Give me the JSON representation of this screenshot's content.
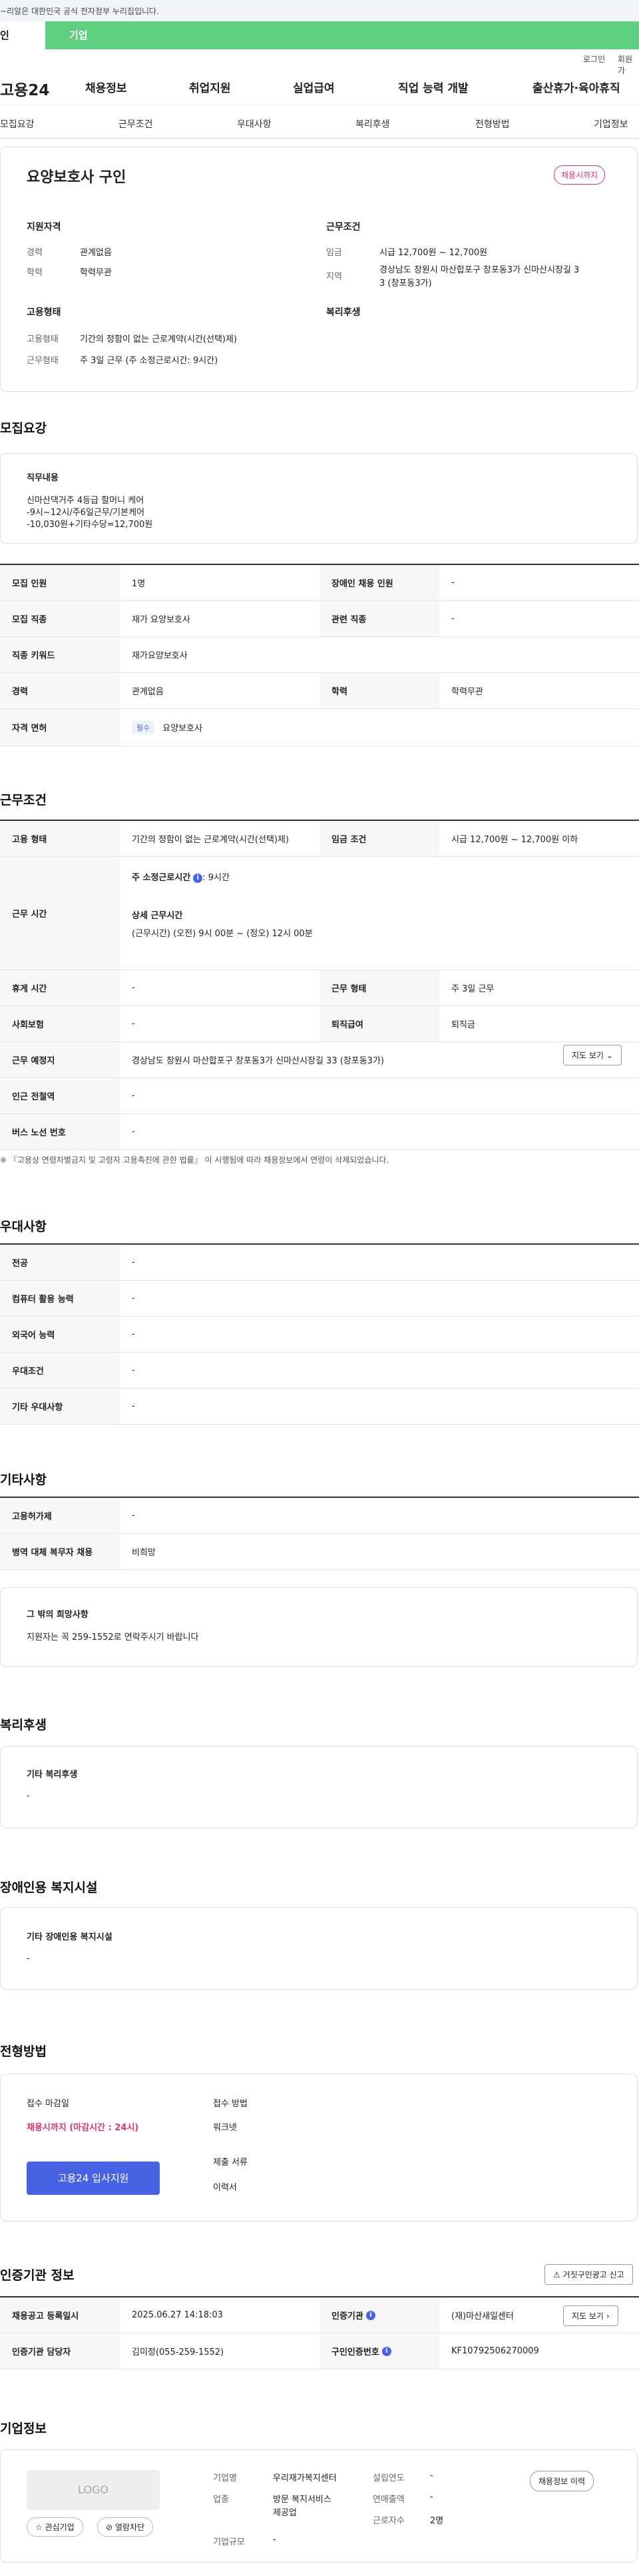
{
  "topbar": {
    "text": "~리알은 대한민국 공식 전자정부 누리집입니다."
  },
  "greentabs": {
    "t1": "인",
    "t2": "기업"
  },
  "util": {
    "login": "로그인",
    "signup": "회원가"
  },
  "nav": {
    "logo": "고용24",
    "items": [
      "채용정보",
      "취업지원",
      "실업급여",
      "직업 능력 개발",
      "출산휴가·육아휴직"
    ]
  },
  "subnav": [
    "모집요강",
    "근무조건",
    "우대사항",
    "복리후생",
    "전형방법",
    "기업정보"
  ],
  "job": {
    "title": "요양보호사 구인",
    "badge": "채용시까지"
  },
  "summary": {
    "qual_title": "지원자격",
    "career_l": "경력",
    "career_v": "관계없음",
    "edu_l": "학력",
    "edu_v": "학력무관",
    "cond_title": "근무조건",
    "wage_l": "임금",
    "wage_v": "시급 12,700원 ~ 12,700원",
    "region_l": "지역",
    "region_v1": "경상남도 창원시 마산합포구 창포동3가 신마산시장길 3",
    "region_v2": "3 (창포동3가)",
    "emp_title": "고용형태",
    "emptype_l": "고용형태",
    "emptype_v": "기간의 정함이 없는 근로계약(시간(선택)제)",
    "worktype_l": "근무형태",
    "worktype_v": "주 3일 근무 (주 소정근로시간: 9시간)",
    "welfare_title": "복리후생"
  },
  "recruit": {
    "section": "모집요강",
    "duty_title": "직무내용",
    "duty1": "신마산댁거주 4등급 할머니 케어",
    "duty2": "-9시~12시/주6일근무/기본케어",
    "duty3": "-10,030원+기타수당=12,700원",
    "rows": [
      [
        "모집 인원",
        "1명",
        "장애인 채용 인원",
        "-"
      ],
      [
        "모집 직종",
        "재가 요양보호사",
        "관련 직종",
        "-"
      ],
      [
        "직종 키워드",
        "재가요양보호사"
      ],
      [
        "경력",
        "관계없음",
        "학력",
        "학력무관"
      ],
      [
        "자격 면허",
        "필수",
        "요양보호사"
      ]
    ]
  },
  "work": {
    "section": "근무조건",
    "emp_th": "고용 형태",
    "emp_td": "기간의 정함이 없는 근로계약(시간(선택)제)",
    "wage_th": "임금 조건",
    "wage_td": "시급 12,700원 ~ 12,700원 이하",
    "time_th": "근무 시간",
    "weekly_label": "주 소정근로시간",
    "weekly_val": ": 9시간",
    "detail_label": "상세 근무시간",
    "detail_val": "(근무시간) (오전) 9시 00분 ~ (정오) 12시 00분",
    "rest_th": "휴게 시간",
    "rest_td": "-",
    "type_th": "근무 형태",
    "type_td": "주 3일 근무",
    "ins_th": "사회보험",
    "ins_td": "-",
    "ret_th": "퇴직급여",
    "ret_td": "퇴직금",
    "place_th": "근무 예정지",
    "place_td": "경상남도 창원시 마산합포구 창포동3가 신마산시장길 33 (창포동3가)",
    "map_btn": "지도 보기",
    "subway_th": "인근 전철역",
    "subway_td": "-",
    "bus_th": "버스 노선 번호",
    "bus_td": "-",
    "note": "※ 『고용상 연령차별금지 및 고령자 고용촉진에 관한 법률』 이 시행됨에 따라 채용정보에서 연령이 삭제되었습니다."
  },
  "pref": {
    "section": "우대사항",
    "rows": [
      [
        "전공",
        "-"
      ],
      [
        "컴퓨터 활용 능력",
        "-"
      ],
      [
        "외국어 능력",
        "-"
      ],
      [
        "우대조건",
        "-"
      ],
      [
        "기타 우대사항",
        "-"
      ]
    ]
  },
  "etc": {
    "section": "기타사항",
    "rows": [
      [
        "고용허가제",
        "-"
      ],
      [
        "병역 대체 복무자 채용",
        "비희망"
      ]
    ],
    "other_title": "그 밖의 희망사항",
    "other_text": "지원자는 꼭 259-1552로 연락주시기 바랍니다"
  },
  "welfare": {
    "section": "복리후생",
    "title": "기타 복리후생",
    "value": "-"
  },
  "disabled": {
    "section": "장애인용 복지시설",
    "title": "기타 장애인용 복지시설",
    "value": "-"
  },
  "process": {
    "section": "전형방법",
    "deadline_l": "접수 마감일",
    "deadline_v": "채용시까지 (마감시간 : 24시)",
    "apply_btn": "고용24 입사지원",
    "method_l": "접수 방법",
    "method_v": "워크넷",
    "docs_l": "제출 서류",
    "docs_v": "이력서"
  },
  "cert": {
    "section": "인증기관 정보",
    "report_btn": "거짓구인광고 신고",
    "reg_th": "채용공고 등록일시",
    "reg_td": "2025.06.27 14:18:03",
    "org_th": "인증기관",
    "org_td": "(재)마산새일센터",
    "map_btn": "지도 보기",
    "mgr_th": "인증기관 담당자",
    "mgr_td": "김미정(055-259-1552)",
    "num_th": "구인인증번호",
    "num_td": "KF10792506270009"
  },
  "company": {
    "section": "기업정보",
    "logo": "LOGO",
    "fav_btn": "관심기업",
    "block_btn": "열람차단",
    "name_l": "기업명",
    "name_v": "우리재가복지센터",
    "ind_l": "업종",
    "ind_v1": "방문 복지서비스",
    "ind_v2": "제공업",
    "size_l": "기업규모",
    "size_v": "-",
    "est_l": "설립연도",
    "est_v": "-",
    "sales_l": "연매출액",
    "sales_v": "-",
    "emp_l": "근로자수",
    "emp_v": "2명",
    "info_btn": "채용정보 이력"
  }
}
